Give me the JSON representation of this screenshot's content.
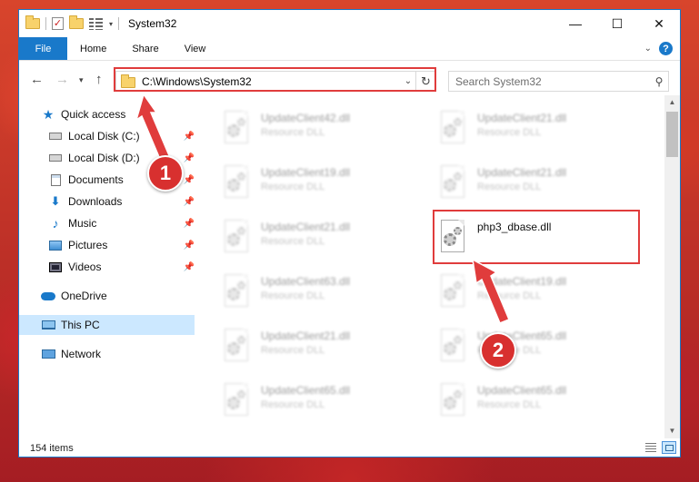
{
  "window": {
    "title": "System32",
    "controls": {
      "minimize": "—",
      "maximize": "☐",
      "close": "✕"
    }
  },
  "ribbon": {
    "tabs": [
      "File",
      "Home",
      "Share",
      "View"
    ]
  },
  "address": {
    "path": "C:\\Windows\\System32",
    "search_placeholder": "Search System32"
  },
  "sidebar": {
    "items": [
      {
        "label": "Quick access",
        "icon": "star-icon",
        "pinned": false
      },
      {
        "label": "Local Disk (C:)",
        "icon": "disk-icon",
        "pinned": true
      },
      {
        "label": "Local Disk (D:)",
        "icon": "disk-icon",
        "pinned": true
      },
      {
        "label": "Documents",
        "icon": "documents-icon",
        "pinned": true
      },
      {
        "label": "Downloads",
        "icon": "downloads-icon",
        "pinned": true
      },
      {
        "label": "Music",
        "icon": "music-icon",
        "pinned": true
      },
      {
        "label": "Pictures",
        "icon": "pictures-icon",
        "pinned": true
      },
      {
        "label": "Videos",
        "icon": "videos-icon",
        "pinned": true
      },
      {
        "label": "OneDrive",
        "icon": "onedrive-icon",
        "pinned": false
      },
      {
        "label": "This PC",
        "icon": "this-pc-icon",
        "pinned": false,
        "selected": true
      },
      {
        "label": "Network",
        "icon": "network-icon",
        "pinned": false
      }
    ]
  },
  "files": [
    {
      "name": "UpdateClient42.dll",
      "type": "Resource DLL",
      "blurred": true
    },
    {
      "name": "UpdateClient21.dll",
      "type": "Resource DLL",
      "blurred": true
    },
    {
      "name": "UpdateClient19.dll",
      "type": "Resource DLL",
      "blurred": true
    },
    {
      "name": "UpdateClient21.dll",
      "type": "Resource DLL",
      "blurred": true
    },
    {
      "name": "UpdateClient21.dll",
      "type": "Resource DLL",
      "blurred": true
    },
    {
      "name": "php3_dbase.dll",
      "type": "",
      "blurred": false
    },
    {
      "name": "UpdateClient63.dll",
      "type": "Resource DLL",
      "blurred": true
    },
    {
      "name": "UpdateClient19.dll",
      "type": "Resource DLL",
      "blurred": true
    },
    {
      "name": "UpdateClient21.dll",
      "type": "Resource DLL",
      "blurred": true
    },
    {
      "name": "UpdateClient65.dll",
      "type": "Resource DLL",
      "blurred": true
    },
    {
      "name": "UpdateClient65.dll",
      "type": "Resource DLL",
      "blurred": true
    },
    {
      "name": "UpdateClient65.dll",
      "type": "Resource DLL",
      "blurred": true
    }
  ],
  "status": {
    "count": "154 items"
  },
  "annotations": {
    "badges": [
      "1",
      "2"
    ],
    "color": "#e03c3c"
  }
}
